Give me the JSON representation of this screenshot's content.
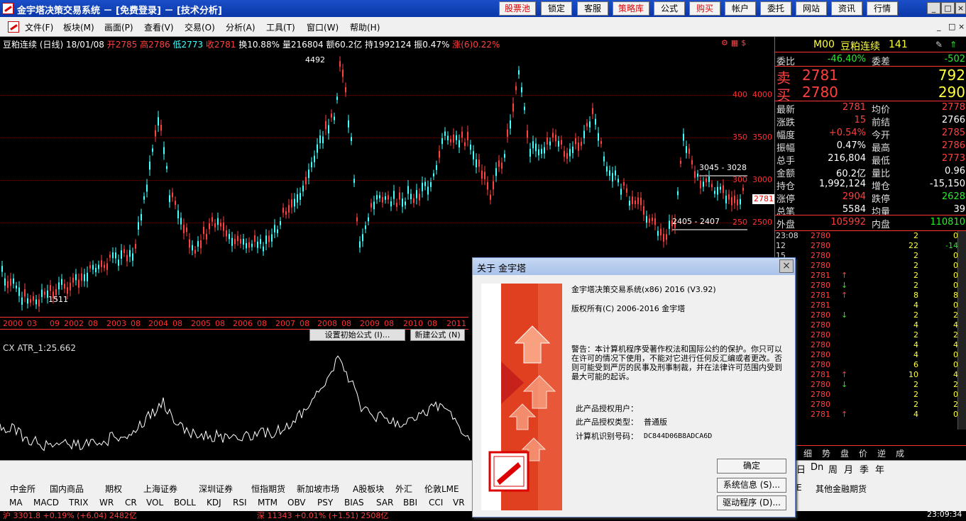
{
  "window": {
    "title": "金宇塔决策交易系统 － [免费登录] － [技术分析]"
  },
  "top_buttons": [
    "股票池",
    "锁定",
    "客服",
    "策略库",
    "公式",
    "购买",
    "帐户",
    "委托",
    "网站",
    "资讯",
    "行情"
  ],
  "window_controls": {
    "minimize": "_",
    "restore": "□",
    "close": "×"
  },
  "menu": [
    "文件(F)",
    "板块(M)",
    "画面(P)",
    "查看(V)",
    "交易(O)",
    "分析(A)",
    "工具(T)",
    "窗口(W)",
    "帮助(H)"
  ],
  "mdi_controls": {
    "minimize": "_",
    "restore": "□",
    "close": "×"
  },
  "chart": {
    "symbol": "豆粕连续 (日线) 18/01/08",
    "open": "开2785",
    "high": "高2786",
    "low": "低2773",
    "close": "收2781",
    "turnover": "换10.88%",
    "volume": "量216804",
    "amount": "额60.2亿",
    "hold": "持1992124",
    "amplitude": "振0.47%",
    "rise": "涨(6)0.22%",
    "y_labels": [
      "4000",
      "3500",
      "3000",
      "2500"
    ],
    "peak_label": "4492",
    "low_label": "1511",
    "level_high": "3045 - 3028",
    "level_low": "2405 - 2407",
    "price_tag": "2781",
    "time_labels": [
      "2000",
      "03",
      "09",
      "2002",
      "08",
      "2003",
      "08",
      "2004",
      "08",
      "2005",
      "08",
      "2006",
      "08",
      "2007",
      "08",
      "2008",
      "08",
      "2009",
      "08",
      "2010",
      "08",
      "2011"
    ],
    "sub_buttons": [
      "设置初始公式 (I)...",
      "新建公式 (N)"
    ],
    "indicator_label": "CX ATR_1:25.662"
  },
  "chart_data": {
    "type": "candlestick",
    "title": "豆粕连续 (日线)",
    "y_axis_ticks": [
      4000,
      3500,
      3000,
      2500
    ],
    "annotations": {
      "peak": 4492,
      "low": 1511,
      "resistance": "3045 - 3028",
      "support": "2405 - 2407"
    },
    "last_close": 2781
  },
  "quote": {
    "code": "M00",
    "name": "豆粕连续",
    "num": "141",
    "weibi_label": "委比",
    "weibi": "-46.40%",
    "weicha_label": "委差",
    "weicha": "-502",
    "sell_label": "卖",
    "sell_price": "2781",
    "sell_vol": "792",
    "buy_label": "买",
    "buy_price": "2780",
    "buy_vol": "290",
    "rows": [
      {
        "l1": "最新",
        "v1": "2781",
        "l2": "均价",
        "v2": "2778"
      },
      {
        "l1": "涨跌",
        "v1": "15",
        "l2": "前结",
        "v2": "2766"
      },
      {
        "l1": "幅度",
        "v1": "+0.54%",
        "l2": "今开",
        "v2": "2785"
      },
      {
        "l1": "振幅",
        "v1": "0.47%",
        "l2": "最高",
        "v2": "2786"
      },
      {
        "l1": "总手",
        "v1": "216,804",
        "l2": "最低",
        "v2": "2773"
      },
      {
        "l1": "金额",
        "v1": "60.2亿",
        "l2": "量比",
        "v2": "0.96"
      },
      {
        "l1": "持仓",
        "v1": "1,992,124",
        "l2": "增仓",
        "v2": "-15,150"
      },
      {
        "l1": "涨停",
        "v1": "2904",
        "l2": "跌停",
        "v2": "2628"
      },
      {
        "l1": "总笔",
        "v1": "5584",
        "l2": "均量",
        "v2": "39"
      }
    ],
    "outer_label": "外盘",
    "outer": "105992",
    "inner_label": "内盘",
    "inner": "110810"
  },
  "ticks": [
    {
      "t": "23:08",
      "p": "2780",
      "a": "",
      "n1": "2",
      "n2": "0"
    },
    {
      "t": "12",
      "p": "2780",
      "a": "",
      "n1": "22",
      "n2": "-14"
    },
    {
      "t": "15",
      "p": "2780",
      "a": "",
      "n1": "2",
      "n2": "0"
    },
    {
      "t": "",
      "p": "2780",
      "a": "",
      "n1": "2",
      "n2": "0"
    },
    {
      "t": "",
      "p": "2781",
      "a": "↑",
      "n1": "2",
      "n2": "0"
    },
    {
      "t": "",
      "p": "2780",
      "a": "↓",
      "n1": "2",
      "n2": "0"
    },
    {
      "t": "",
      "p": "2781",
      "a": "↑",
      "n1": "8",
      "n2": "8"
    },
    {
      "t": "",
      "p": "2781",
      "a": "",
      "n1": "4",
      "n2": "0"
    },
    {
      "t": "",
      "p": "2780",
      "a": "↓",
      "n1": "2",
      "n2": "2"
    },
    {
      "t": "",
      "p": "2780",
      "a": "",
      "n1": "4",
      "n2": "4"
    },
    {
      "t": "",
      "p": "2780",
      "a": "",
      "n1": "2",
      "n2": "2"
    },
    {
      "t": "",
      "p": "2780",
      "a": "",
      "n1": "4",
      "n2": "4"
    },
    {
      "t": "",
      "p": "2780",
      "a": "",
      "n1": "4",
      "n2": "0"
    },
    {
      "t": "",
      "p": "2780",
      "a": "",
      "n1": "6",
      "n2": "0"
    },
    {
      "t": "",
      "p": "2781",
      "a": "↑",
      "n1": "10",
      "n2": "4"
    },
    {
      "t": "",
      "p": "2780",
      "a": "↓",
      "n1": "2",
      "n2": "2"
    },
    {
      "t": "",
      "p": "2780",
      "a": "",
      "n1": "2",
      "n2": "0"
    },
    {
      "t": "",
      "p": "2780",
      "a": "",
      "n1": "2",
      "n2": "2"
    },
    {
      "t": "",
      "p": "2781",
      "a": "↑",
      "n1": "4",
      "n2": "0"
    }
  ],
  "right_tabs": [
    "细",
    "势",
    "盘",
    "价",
    "逆",
    "成"
  ],
  "period_tabs": [
    "日",
    "Dn",
    "周",
    "月",
    "季",
    "年"
  ],
  "market_tabs": [
    "中金所",
    "国内商品",
    "期权",
    "上海证券",
    "深圳证券",
    "恒指期货",
    "新加坡市场",
    "A股板块",
    "外汇",
    "伦敦LME",
    "E",
    "其他金融期货"
  ],
  "indicator_tabs": [
    "MA",
    "MACD",
    "TRIX",
    "WR",
    "CR",
    "VOL",
    "BOLL",
    "KDJ",
    "RSI",
    "MTM",
    "OBV",
    "PSY",
    "BIAS",
    "SAR",
    "BBI",
    "CCI",
    "VR"
  ],
  "status": {
    "sh": "沪 3301.8 +0.19% (+6.04) 2482亿",
    "sz": "深 11343 +0.01% (+1.51) 2508亿",
    "time": "23:09:34"
  },
  "dialog": {
    "title": "关于 金宇塔",
    "product": "金宇塔决策交易系统(x86) 2016 (V3.92)",
    "copyright": "版权所有(C) 2006-2016 金宇塔",
    "warning": "警告：本计算机程序受著作权法和国际公约的保护。你只可以在许可的情况下使用，不能对它进行任何反汇编或者更改。否则可能受到严厉的民事及刑事制裁，并在法律许可范围内受到最大可能的起诉。",
    "user_label": "此产品授权用户：",
    "type_label": "此产品授权类型：",
    "type_value": "普通版",
    "machine_label": "计算机识别号码：",
    "machine_value": "DC844D06B8ADCA6D",
    "ok": "确定",
    "sysinfo": "系统信息 (S)...",
    "driver": "驱动程序 (D)...",
    "close": "×"
  },
  "colors": {
    "up": "#ff4040",
    "down": "#40ffff",
    "accent": "#d00000",
    "panel_border": "#ff3333"
  }
}
